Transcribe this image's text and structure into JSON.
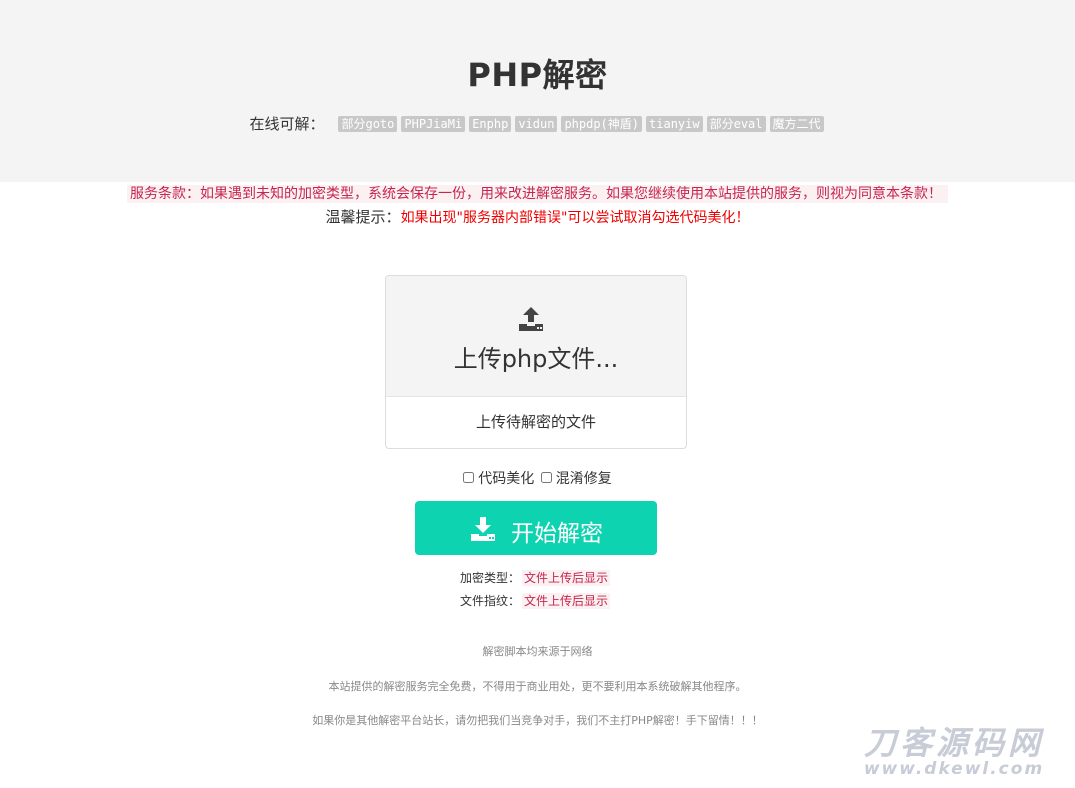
{
  "header": {
    "title": "PHP解密",
    "supported_label": "在线可解：",
    "tags": [
      "部分goto",
      "PHPJiaMi",
      "Enphp",
      "vidun",
      "phpdp(神盾)",
      "tianyiw",
      "部分eval",
      "魔方二代"
    ]
  },
  "notice": {
    "terms": "服务条款：如果遇到未知的加密类型，系统会保存一份，用来改进解密服务。如果您继续使用本站提供的服务，则视为同意本条款！",
    "tip_label": "温馨提示：",
    "tip_text": "如果出现\"服务器内部错误\"可以尝试取消勾选代码美化！"
  },
  "upload": {
    "icon": "upload-icon",
    "title": "上传php文件...",
    "subtitle": "上传待解密的文件"
  },
  "options": {
    "beautify_label": "代码美化",
    "obfuscation_label": "混淆修复"
  },
  "action": {
    "icon": "download-icon",
    "start_label": "开始解密"
  },
  "result": {
    "type_label": "加密类型：",
    "type_value": "文件上传后显示",
    "fingerprint_label": "文件指纹：",
    "fingerprint_value": "文件上传后显示"
  },
  "footer": {
    "line1": "解密脚本均来源于网络",
    "line2": "本站提供的解密服务完全免费，不得用于商业用处，更不要利用本系统破解其他程序。",
    "line3": "如果你是其他解密平台站长，请勿把我们当竞争对手，我们不主打PHP解密！手下留情！！！"
  },
  "watermark": {
    "text": "刀客源码网",
    "url": "www.dkewl.com"
  },
  "colors": {
    "accent": "#0ed3b0",
    "hero_bg": "#f4f4f4",
    "code_red": "#c7254e",
    "warn_red": "#ee0000"
  }
}
